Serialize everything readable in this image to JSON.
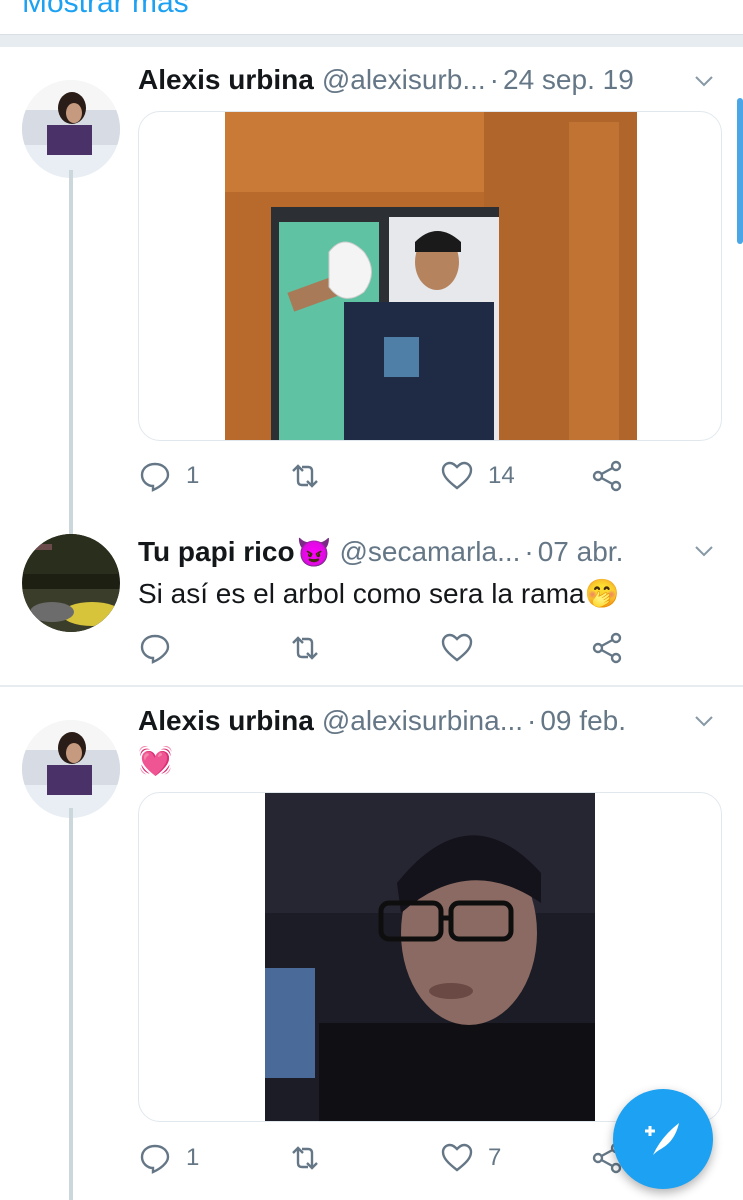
{
  "top_link": "Mostrar más",
  "tweets": [
    {
      "name": "Alexis urbina",
      "handle": "@alexisurb...",
      "date": "24 sep. 19",
      "replies": "1",
      "likes": "14"
    },
    {
      "name": "Tu papi rico",
      "name_emoji": "😈",
      "handle": "@secamarla...",
      "date": "07 abr.",
      "text": "Si así es el arbol como sera la rama",
      "text_emoji": "🤭"
    },
    {
      "name": "Alexis urbina",
      "handle": "@alexisurbina...",
      "date": "09 feb.",
      "text_emoji": "💓",
      "replies": "1",
      "likes": "7"
    }
  ],
  "icons": [
    "reply-icon",
    "retweet-icon",
    "like-icon",
    "share-icon",
    "chevron-down-icon",
    "compose-tweet-icon"
  ],
  "colors": {
    "accent": "#1da1f2",
    "muted": "#657786",
    "divider": "#e6ecf0"
  }
}
